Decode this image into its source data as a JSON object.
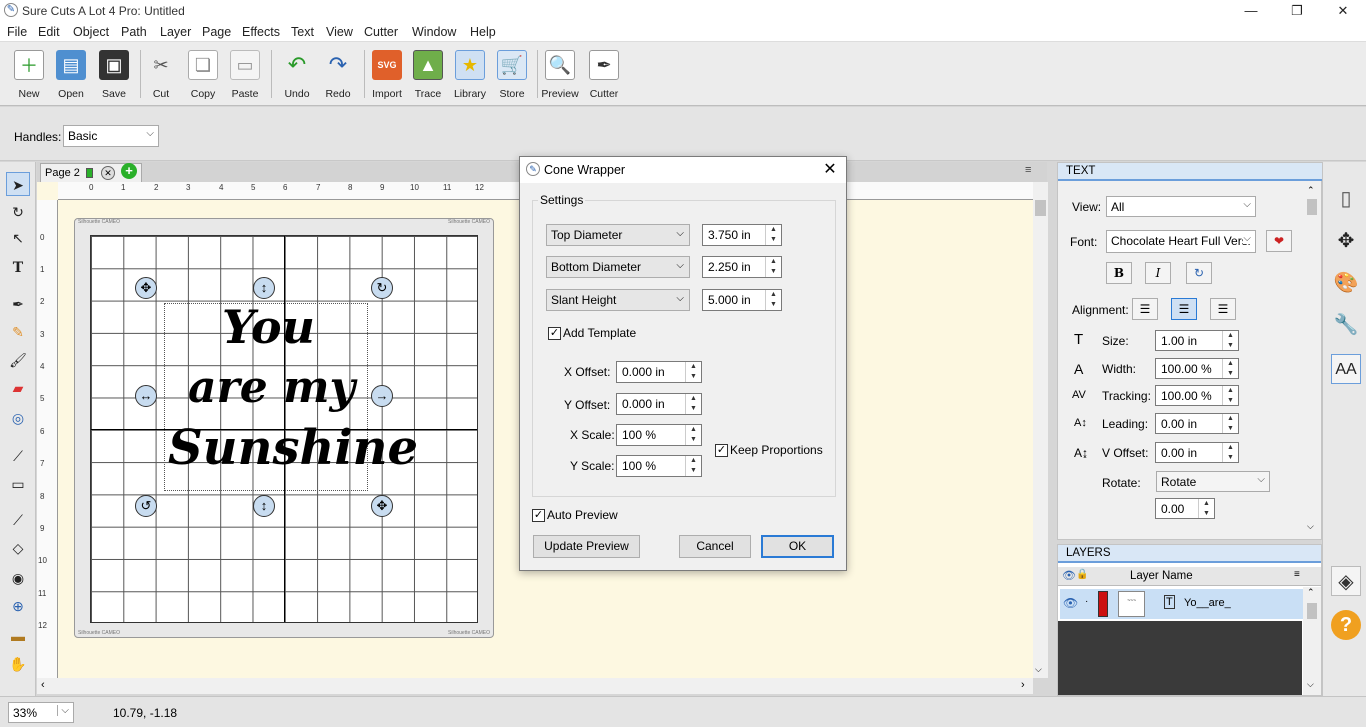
{
  "window": {
    "title": "Sure Cuts A Lot 4 Pro: Untitled"
  },
  "menu": [
    "File",
    "Edit",
    "Object",
    "Path",
    "Layer",
    "Page",
    "Effects",
    "Text",
    "View",
    "Cutter",
    "Window",
    "Help"
  ],
  "toolbar": [
    {
      "label": "New",
      "icon": "new-icon"
    },
    {
      "label": "Open",
      "icon": "open-icon"
    },
    {
      "label": "Save",
      "icon": "save-icon"
    },
    {
      "label": "Cut",
      "icon": "cut-icon"
    },
    {
      "label": "Copy",
      "icon": "copy-icon"
    },
    {
      "label": "Paste",
      "icon": "paste-icon"
    },
    {
      "label": "Undo",
      "icon": "undo-icon"
    },
    {
      "label": "Redo",
      "icon": "redo-icon"
    },
    {
      "label": "Import",
      "icon": "import-icon"
    },
    {
      "label": "Trace",
      "icon": "trace-icon"
    },
    {
      "label": "Library",
      "icon": "library-icon"
    },
    {
      "label": "Store",
      "icon": "store-icon"
    },
    {
      "label": "Preview",
      "icon": "preview-icon"
    },
    {
      "label": "Cutter",
      "icon": "cutter-icon"
    }
  ],
  "handles": {
    "label": "Handles:",
    "value": "Basic"
  },
  "page_tab": {
    "label": "Page 2"
  },
  "ruler": {
    "h": [
      "0",
      "1",
      "2",
      "3",
      "4",
      "5",
      "6",
      "7",
      "8",
      "9",
      "10",
      "11",
      "12"
    ],
    "v": [
      "0",
      "1",
      "2",
      "3",
      "4",
      "5",
      "6",
      "7",
      "8",
      "9",
      "10",
      "11",
      "12"
    ]
  },
  "artwork": {
    "line1": "You",
    "line2": "are my",
    "line3": "Sunshine"
  },
  "mat": {
    "brand_tl": "Silhouette CAMEO",
    "brand_tr": "Silhouette CAMEO",
    "brand_bl": "Silhouette CAMEO",
    "brand_br": "Silhouette CAMEO"
  },
  "dialog": {
    "title": "Cone Wrapper",
    "settings_label": "Settings",
    "rows": [
      {
        "dropdown": "Top Diameter",
        "value": "3.750 in"
      },
      {
        "dropdown": "Bottom Diameter",
        "value": "2.250 in"
      },
      {
        "dropdown": "Slant Height",
        "value": "5.000 in"
      }
    ],
    "add_template": "Add Template",
    "x_offset_label": "X Offset:",
    "x_offset": "0.000 in",
    "y_offset_label": "Y Offset:",
    "y_offset": "0.000 in",
    "x_scale_label": "X Scale:",
    "x_scale": "100 %",
    "y_scale_label": "Y Scale:",
    "y_scale": "100 %",
    "keep_proportions": "Keep Proportions",
    "auto_preview": "Auto Preview",
    "update_preview": "Update Preview",
    "cancel": "Cancel",
    "ok": "OK"
  },
  "text_panel": {
    "header": "TEXT",
    "view_label": "View:",
    "view_value": "All",
    "font_label": "Font:",
    "font_value": "Chocolate Heart Full Versi",
    "bold": "B",
    "italic": "I",
    "alignment_label": "Alignment:",
    "size_label": "Size:",
    "size": "1.00 in",
    "width_label": "Width:",
    "width": "100.00 %",
    "tracking_label": "Tracking:",
    "tracking": "100.00 %",
    "leading_label": "Leading:",
    "leading": "0.00 in",
    "voffset_label": "V Offset:",
    "voffset": "0.00 in",
    "rotate_label": "Rotate:",
    "rotate_mode": "Rotate",
    "rotate_value": "0.00"
  },
  "layers_panel": {
    "header": "LAYERS",
    "column": "Layer Name",
    "layer_name": "Yo__are_",
    "layer_color": "#cc1111"
  },
  "status": {
    "zoom": "33%",
    "coords": "10.79, -1.18"
  },
  "colors": {
    "accent": "#6b9edb",
    "canvas": "#fdf8e1",
    "handle": "#c8dcf0"
  }
}
